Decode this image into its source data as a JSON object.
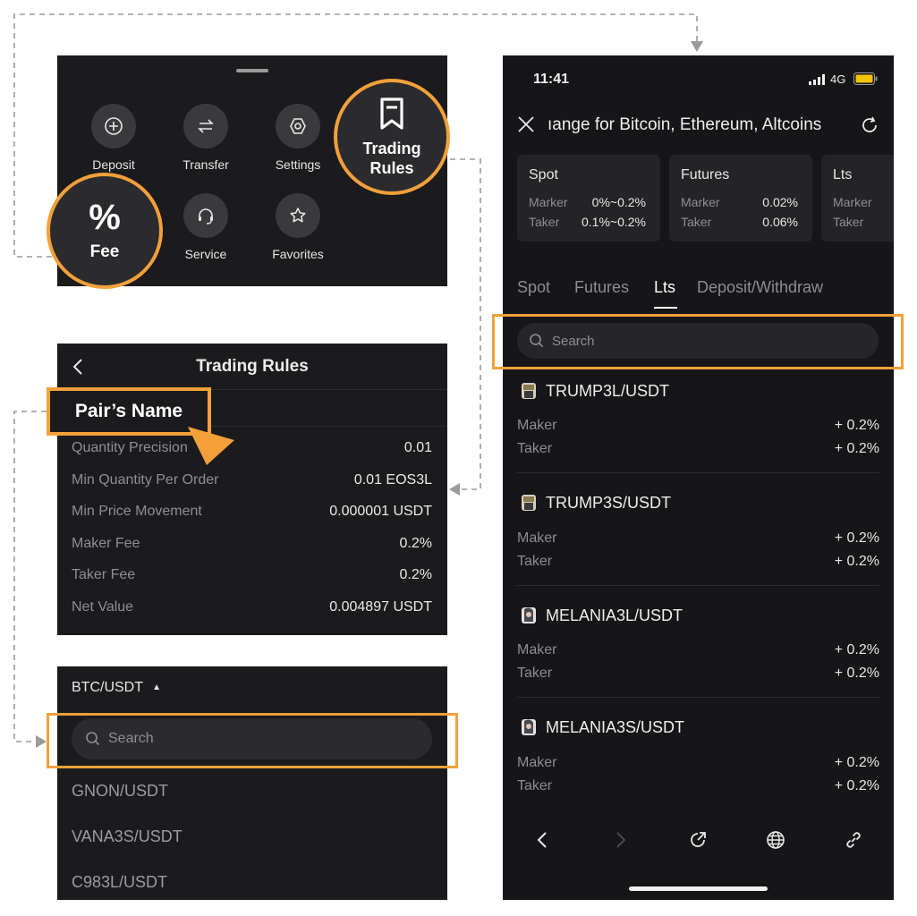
{
  "colors": {
    "accent": "#f3a03a",
    "panel_bg": "#1b1b1d",
    "muted_text": "#8f8f93"
  },
  "menu": {
    "items": [
      {
        "label": "Deposit",
        "icon": "plus-circle-icon"
      },
      {
        "label": "Transfer",
        "icon": "transfer-arrows-icon"
      },
      {
        "label": "Settings",
        "icon": "hexagon-settings-icon"
      },
      {
        "label": "Service",
        "icon": "headset-icon"
      },
      {
        "label": "Favorites",
        "icon": "star-icon"
      }
    ],
    "fee_label": "Fee",
    "fee_symbol": "%",
    "trading_rules_line1": "Trading",
    "trading_rules_line2": "Rules"
  },
  "rules": {
    "title": "Trading Rules",
    "pair_name_label": "Pair’s Name",
    "rows": [
      {
        "label": "Quantity Precision",
        "value": "0.01"
      },
      {
        "label": "Min Quantity Per Order",
        "value": "0.01 EOS3L"
      },
      {
        "label": "Min Price Movement",
        "value": "0.000001 USDT"
      },
      {
        "label": "Maker Fee",
        "value": "0.2%"
      },
      {
        "label": "Taker Fee",
        "value": "0.2%"
      },
      {
        "label": "Net Value",
        "value": "0.004897 USDT"
      }
    ]
  },
  "pair_selector": {
    "current_pair": "BTC/USDT",
    "caret": "▲",
    "search_placeholder": "Search",
    "pairs": [
      "GNON/USDT",
      "VANA3S/USDT",
      "C983L/USDT"
    ]
  },
  "phone": {
    "status": {
      "time": "11:41",
      "network": "4G"
    },
    "page_title": "ıange for Bitcoin, Ethereum, Altcoins",
    "cards": [
      {
        "title": "Spot",
        "maker_label": "Marker",
        "maker_value": "0%~0.2%",
        "taker_label": "Taker",
        "taker_value": "0.1%~0.2%"
      },
      {
        "title": "Futures",
        "maker_label": "Marker",
        "maker_value": "0.02%",
        "taker_label": "Taker",
        "taker_value": "0.06%"
      },
      {
        "title": "Lts",
        "maker_label": "Marker",
        "maker_value": "",
        "taker_label": "Taker",
        "taker_value": ""
      }
    ],
    "tabs": [
      "Spot",
      "Futures",
      "Lts",
      "Deposit/Withdraw"
    ],
    "active_tab": "Lts",
    "search_placeholder": "Search",
    "pairs": [
      {
        "name": "TRUMP3L/USDT",
        "maker_label": "Maker",
        "maker": "+ 0.2%",
        "taker_label": "Taker",
        "taker": "+ 0.2%"
      },
      {
        "name": "TRUMP3S/USDT",
        "maker_label": "Maker",
        "maker": "+ 0.2%",
        "taker_label": "Taker",
        "taker": "+ 0.2%"
      },
      {
        "name": "MELANIA3L/USDT",
        "maker_label": "Maker",
        "maker": "+ 0.2%",
        "taker_label": "Taker",
        "taker": "+ 0.2%"
      },
      {
        "name": "MELANIA3S/USDT",
        "maker_label": "Maker",
        "maker": "+ 0.2%",
        "taker_label": "Taker",
        "taker": "+ 0.2%"
      }
    ],
    "bottom_nav": [
      "back-icon",
      "forward-icon",
      "share-icon",
      "globe-icon",
      "link-icon"
    ]
  }
}
